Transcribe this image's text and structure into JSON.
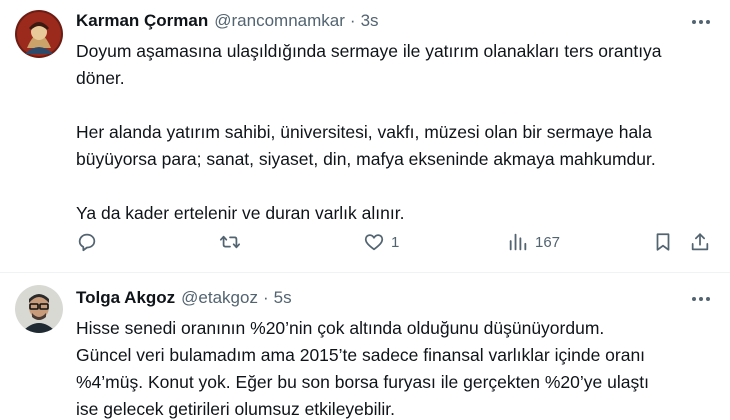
{
  "tweets": [
    {
      "author_name": "Karman Çorman",
      "handle": "@rancomnamkar",
      "separator": "·",
      "time": "3s",
      "lines": [
        "Doyum aşamasına ulaşıldığında sermaye ile yatırım olanakları ters orantıya",
        "döner.",
        "",
        "Her alanda yatırım sahibi, üniversitesi, vakfı, müzesi olan bir sermaye hala",
        "büyüyorsa para; sanat, siyaset, din, mafya ekseninde akmaya mahkumdur.",
        "",
        "Ya da kader ertelenir ve duran varlık alınır."
      ],
      "actions": {
        "reply_count": "",
        "retweet_count": "",
        "like_count": "1",
        "views_count": "167"
      }
    },
    {
      "author_name": "Tolga Akgoz",
      "handle": "@etakgoz",
      "separator": "·",
      "time": "5s",
      "lines": [
        "Hisse senedi oranının %20’nin çok altında olduğunu düşünüyordum.",
        "Güncel veri bulamadım ama 2015’te sadece finansal varlıklar içinde oranı",
        "%4’müş. Konut yok. Eğer bu son borsa furyası ile gerçekten %20’ye ulaştı",
        "ise gelecek getirileri olumsuz etkileyebilir."
      ]
    }
  ],
  "icons": {
    "more": "more-horizontal-icon",
    "reply": "reply-icon",
    "retweet": "retweet-icon",
    "like": "heart-icon",
    "views": "views-chart-icon",
    "bookmark": "bookmark-icon",
    "share": "share-icon"
  },
  "colors": {
    "text_primary": "#0f1419",
    "text_secondary": "#536471",
    "divider": "#eff3f4"
  }
}
